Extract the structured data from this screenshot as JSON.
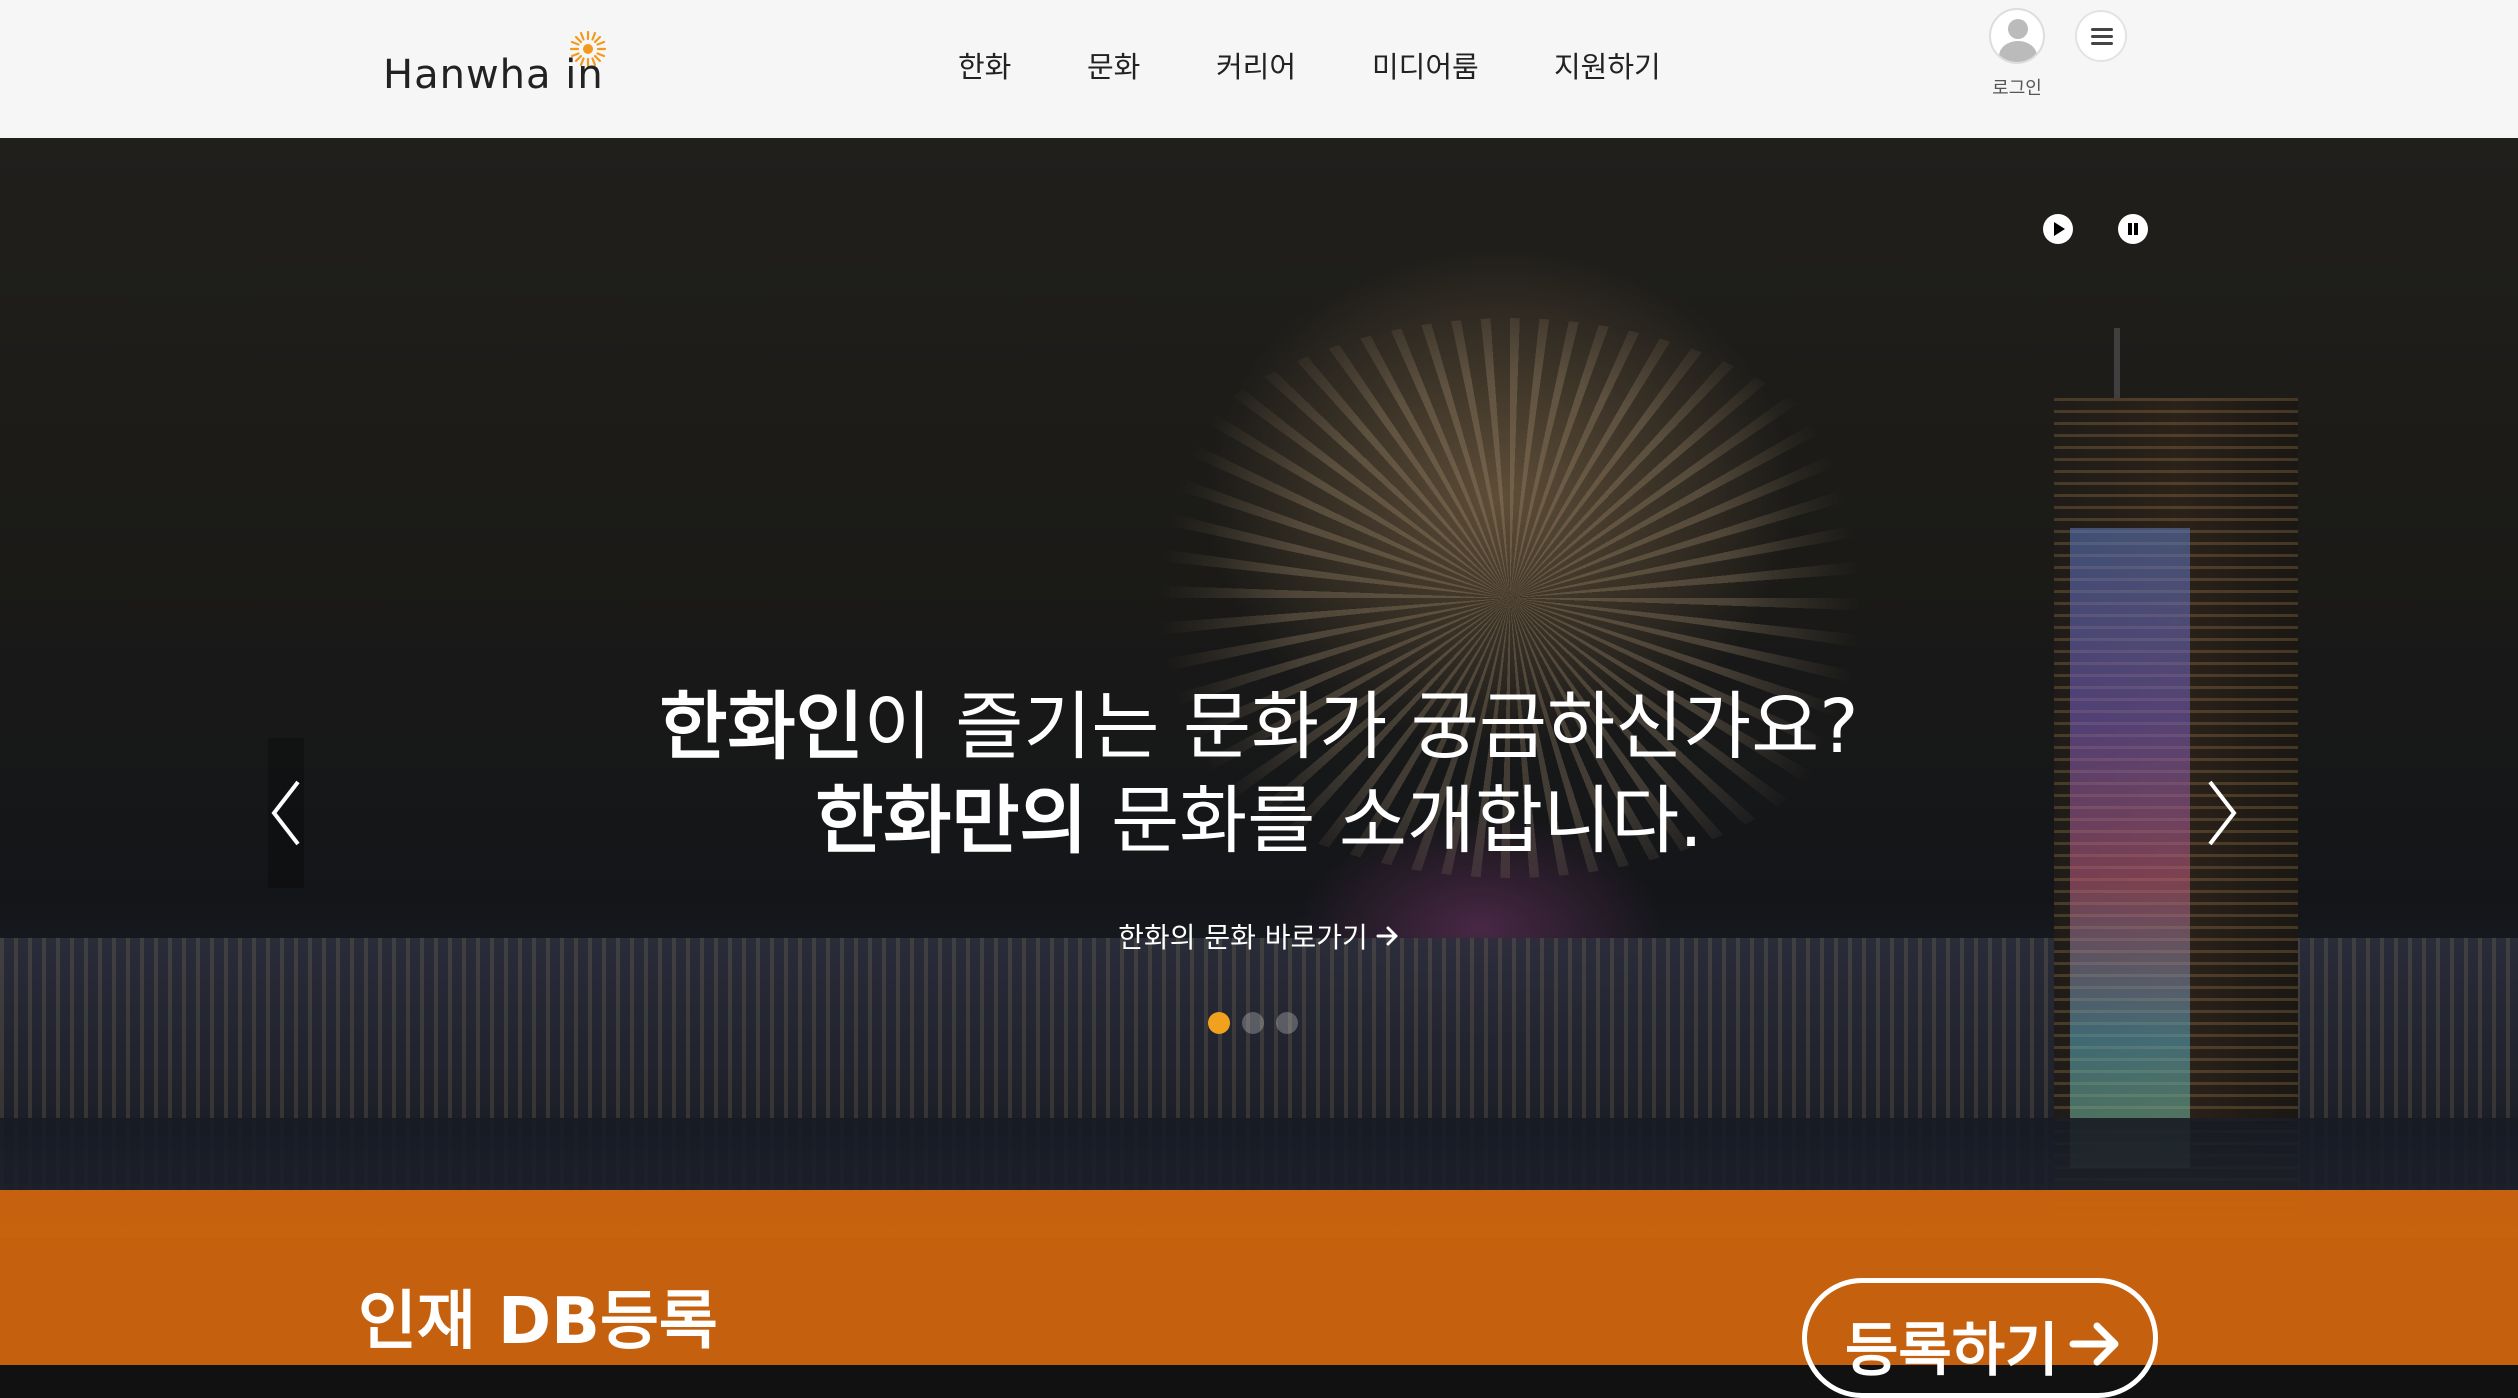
{
  "brand": {
    "logo_main": "Hanwha",
    "logo_sub": "in",
    "accent": "#e8871e"
  },
  "nav": {
    "items": [
      "한화",
      "문화",
      "커리어",
      "미디어룸",
      "지원하기"
    ]
  },
  "account": {
    "login_label": "로그인"
  },
  "hero": {
    "headline_line1_bold": "한화인",
    "headline_line1_rest": "이 즐기는 문화가 궁금하신가요?",
    "headline_line2_bold": "한화만의",
    "headline_line2_rest": " 문화를 소개합니다.",
    "cta_label": "한화의 문화 바로가기",
    "slides_total": 3,
    "slide_active": 1,
    "dot_active_color": "#f0a21e"
  },
  "band": {
    "title": "인재 DB등록",
    "button_label": "등록하기",
    "color": "#e26e0a"
  }
}
